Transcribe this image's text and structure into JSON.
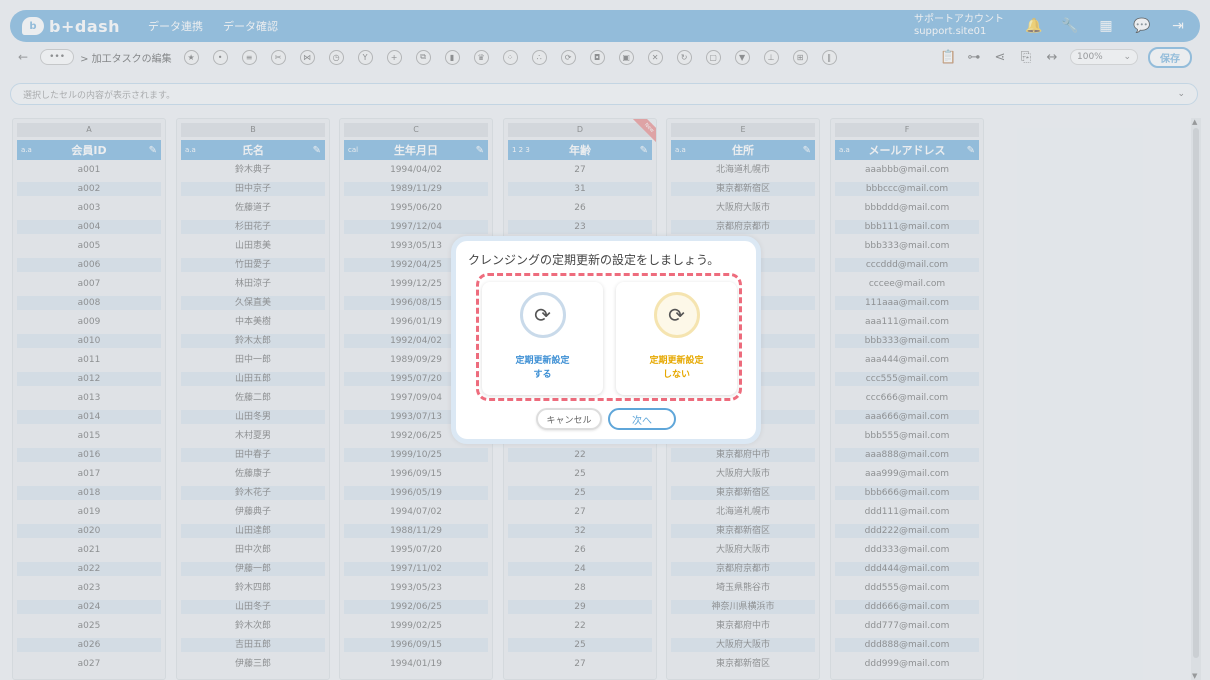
{
  "header": {
    "logo_text": "b+dash",
    "nav": [
      "データ連携",
      "データ確認"
    ],
    "account_line1": "サポートアカウント",
    "account_line2": "support.site01"
  },
  "toolbar": {
    "back": "←",
    "more": "•••",
    "breadcrumb": "> 加工タスクの編集",
    "tool_icons": [
      "star",
      "more",
      "list",
      "scissors",
      "merge",
      "timer",
      "branch",
      "plus",
      "copy",
      "trash",
      "crown",
      "group",
      "dots",
      "refresh",
      "bag",
      "box",
      "close",
      "cycle",
      "frame",
      "filter",
      "tree",
      "grid",
      "split"
    ],
    "zoom": "100%",
    "save_label": "保存"
  },
  "cellbar": {
    "placeholder": "選択したセルの内容が表示されます。"
  },
  "columns": [
    {
      "letter": "A",
      "header": "会員ID",
      "type": "a-z",
      "type_badge": "a.a",
      "cells": [
        "a001",
        "a002",
        "a003",
        "a004",
        "a005",
        "a006",
        "a007",
        "a008",
        "a009",
        "a010",
        "a011",
        "a012",
        "a013",
        "a014",
        "a015",
        "a016",
        "a017",
        "a018",
        "a019",
        "a020",
        "a021",
        "a022",
        "a023",
        "a024",
        "a025",
        "a026",
        "a027"
      ]
    },
    {
      "letter": "B",
      "header": "氏名",
      "type_badge": "a.a",
      "cells": [
        "鈴木典子",
        "田中京子",
        "佐藤道子",
        "杉田花子",
        "山田恵美",
        "竹田愛子",
        "林田涼子",
        "久保直美",
        "中本美樹",
        "鈴木太郎",
        "田中一郎",
        "山田五郎",
        "佐藤二郎",
        "山田冬男",
        "木村夏男",
        "田中春子",
        "佐藤康子",
        "鈴木花子",
        "伊藤典子",
        "山田達郎",
        "田中次郎",
        "伊藤一郎",
        "鈴木四郎",
        "山田冬子",
        "鈴木次郎",
        "吉田五郎",
        "伊藤三郎"
      ]
    },
    {
      "letter": "C",
      "header": "生年月日",
      "type_badge": "cal",
      "cells": [
        "1994/04/02",
        "1989/11/29",
        "1995/06/20",
        "1997/12/04",
        "1993/05/13",
        "1992/04/25",
        "1999/12/25",
        "1996/08/15",
        "1996/01/19",
        "1992/04/02",
        "1989/09/29",
        "1995/07/20",
        "1997/09/04",
        "1993/07/13",
        "1992/06/25",
        "1999/10/25",
        "1996/09/15",
        "1996/05/19",
        "1994/07/02",
        "1988/11/29",
        "1995/07/20",
        "1997/11/02",
        "1993/05/23",
        "1992/06/25",
        "1999/02/25",
        "1996/09/15",
        "1994/01/19"
      ]
    },
    {
      "letter": "D",
      "header": "年齢",
      "type_badge": "1 2 3",
      "ribbon": "New",
      "cells": [
        "27",
        "31",
        "26",
        "23",
        "",
        "",
        "",
        "",
        "",
        "",
        "",
        "",
        "",
        "",
        "",
        "22",
        "25",
        "25",
        "27",
        "32",
        "26",
        "24",
        "28",
        "29",
        "22",
        "25",
        "27"
      ]
    },
    {
      "letter": "E",
      "header": "住所",
      "type_badge": "a.a",
      "cells": [
        "北海道札幌市",
        "東京都新宿区",
        "大阪府大阪市",
        "京都府京都市",
        "",
        "",
        "",
        "",
        "",
        "",
        "",
        "",
        "",
        "",
        "",
        "東京都府中市",
        "大阪府大阪市",
        "東京都新宿区",
        "北海道札幌市",
        "東京都新宿区",
        "大阪府大阪市",
        "京都府京都市",
        "埼玉県熊谷市",
        "神奈川県横浜市",
        "東京都府中市",
        "大阪府大阪市",
        "東京都新宿区"
      ]
    },
    {
      "letter": "F",
      "header": "メールアドレス",
      "type_badge": "a.a",
      "cells": [
        "aaabbb@mail.com",
        "bbbccc@mail.com",
        "bbbddd@mail.com",
        "bbb111@mail.com",
        "bbb333@mail.com",
        "cccddd@mail.com",
        "cccee@mail.com",
        "111aaa@mail.com",
        "aaa111@mail.com",
        "bbb333@mail.com",
        "aaa444@mail.com",
        "ccc555@mail.com",
        "ccc666@mail.com",
        "aaa666@mail.com",
        "bbb555@mail.com",
        "aaa888@mail.com",
        "aaa999@mail.com",
        "bbb666@mail.com",
        "ddd111@mail.com",
        "ddd222@mail.com",
        "ddd333@mail.com",
        "ddd444@mail.com",
        "ddd555@mail.com",
        "ddd666@mail.com",
        "ddd777@mail.com",
        "ddd888@mail.com",
        "ddd999@mail.com"
      ]
    }
  ],
  "partial_cells": {
    "D": {
      "3": "23",
      "4": "",
      "15": "22"
    },
    "E_visible_behind": [
      "市",
      "市",
      "市",
      "市",
      "区",
      "区",
      "市",
      "市",
      "区",
      "区",
      "市",
      "浜市"
    ]
  },
  "modal": {
    "title": "クレンジングの定期更新の設定をしましょう。",
    "option_a": "定期更新設定\nする",
    "option_b": "定期更新設定\nしない",
    "cancel_label": "キャンセル",
    "next_label": "次へ"
  },
  "colors": {
    "accent": "#5fa6d9",
    "dashed_highlight": "#ee6c7d",
    "option_b_text": "#e6a800",
    "option_a_text": "#3d8fd4"
  }
}
